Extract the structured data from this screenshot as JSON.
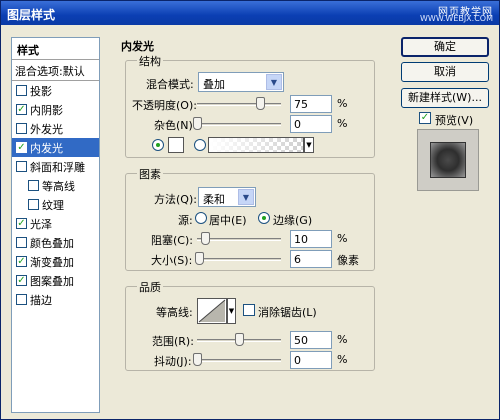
{
  "window": {
    "title": "图层样式",
    "watermark_top": "网页教学网",
    "watermark_bottom": "WWW.WEBJX.COM"
  },
  "sidebar": {
    "header": "样式",
    "blend_options": "混合选项:默认",
    "items": [
      {
        "label": "投影",
        "checked": false
      },
      {
        "label": "内阴影",
        "checked": true
      },
      {
        "label": "外发光",
        "checked": false
      },
      {
        "label": "内发光",
        "checked": true,
        "selected": true
      },
      {
        "label": "斜面和浮雕",
        "checked": false
      },
      {
        "label": "等高线",
        "checked": false,
        "sub": true
      },
      {
        "label": "纹理",
        "checked": false,
        "sub": true
      },
      {
        "label": "光泽",
        "checked": true
      },
      {
        "label": "颜色叠加",
        "checked": false
      },
      {
        "label": "渐变叠加",
        "checked": true
      },
      {
        "label": "图案叠加",
        "checked": true
      },
      {
        "label": "描边",
        "checked": false
      }
    ]
  },
  "buttons": {
    "ok": "确定",
    "cancel": "取消",
    "new_style": "新建样式(W)...",
    "preview": "预览(V)",
    "preview_checked": true
  },
  "panel": {
    "title": "内发光",
    "structure": {
      "title": "结构",
      "blend_mode_label": "混合模式:",
      "blend_mode_value": "叠加",
      "opacity_label": "不透明度(O):",
      "opacity_value": "75",
      "opacity_unit": "%",
      "opacity_fraction": 0.75,
      "noise_label": "杂色(N):",
      "noise_value": "0",
      "noise_unit": "%",
      "noise_fraction": 0
    },
    "elements": {
      "title": "图素",
      "method_label": "方法(Q):",
      "method_value": "柔和",
      "source_label": "源:",
      "center_label": "居中(E)",
      "edge_label": "边缘(G)",
      "choke_label": "阻塞(C):",
      "choke_value": "10",
      "choke_unit": "%",
      "choke_fraction": 0.1,
      "size_label": "大小(S):",
      "size_value": "6",
      "size_unit": "像素",
      "size_fraction": 0.024
    },
    "quality": {
      "title": "品质",
      "contour_label": "等高线:",
      "antialias_label": "消除锯齿(L)",
      "range_label": "范围(R):",
      "range_value": "50",
      "range_unit": "%",
      "range_fraction": 0.5,
      "jitter_label": "抖动(J):",
      "jitter_value": "0",
      "jitter_unit": "%",
      "jitter_fraction": 0
    }
  }
}
